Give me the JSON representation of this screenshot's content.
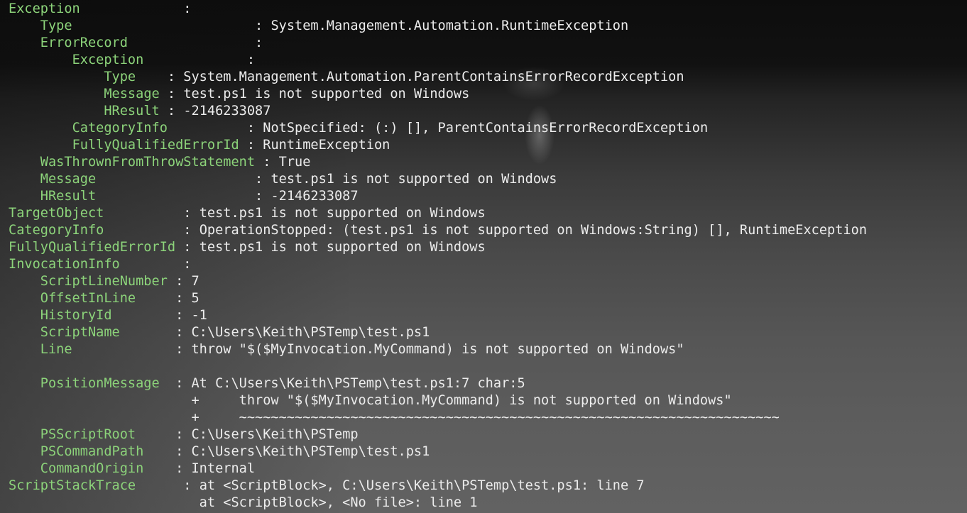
{
  "lines": [
    {
      "indent": "",
      "key": "Exception",
      "sep": "             :",
      "value": ""
    },
    {
      "indent": "    ",
      "key": "Type",
      "sep": "                       : ",
      "value": "System.Management.Automation.RuntimeException"
    },
    {
      "indent": "    ",
      "key": "ErrorRecord",
      "sep": "                : ",
      "value": ""
    },
    {
      "indent": "        ",
      "key": "Exception",
      "sep": "             :",
      "value": ""
    },
    {
      "indent": "            ",
      "key": "Type",
      "sep": "    : ",
      "value": "System.Management.Automation.ParentContainsErrorRecordException"
    },
    {
      "indent": "            ",
      "key": "Message",
      "sep": " : ",
      "value": "test.ps1 is not supported on Windows"
    },
    {
      "indent": "            ",
      "key": "HResult",
      "sep": " : ",
      "value": "-2146233087"
    },
    {
      "indent": "        ",
      "key": "CategoryInfo",
      "sep": "          : ",
      "value": "NotSpecified: (:) [], ParentContainsErrorRecordException"
    },
    {
      "indent": "        ",
      "key": "FullyQualifiedErrorId",
      "sep": " : ",
      "value": "RuntimeException"
    },
    {
      "indent": "    ",
      "key": "WasThrownFromThrowStatement",
      "sep": " : ",
      "value": "True"
    },
    {
      "indent": "    ",
      "key": "Message",
      "sep": "                    : ",
      "value": "test.ps1 is not supported on Windows"
    },
    {
      "indent": "    ",
      "key": "HResult",
      "sep": "                    : ",
      "value": "-2146233087"
    },
    {
      "indent": "",
      "key": "TargetObject",
      "sep": "          : ",
      "value": "test.ps1 is not supported on Windows"
    },
    {
      "indent": "",
      "key": "CategoryInfo",
      "sep": "          : ",
      "value": "OperationStopped: (test.ps1 is not supported on Windows:String) [], RuntimeException"
    },
    {
      "indent": "",
      "key": "FullyQualifiedErrorId",
      "sep": " : ",
      "value": "test.ps1 is not supported on Windows"
    },
    {
      "indent": "",
      "key": "InvocationInfo",
      "sep": "        :",
      "value": ""
    },
    {
      "indent": "    ",
      "key": "ScriptLineNumber",
      "sep": " : ",
      "value": "7"
    },
    {
      "indent": "    ",
      "key": "OffsetInLine",
      "sep": "     : ",
      "value": "5"
    },
    {
      "indent": "    ",
      "key": "HistoryId",
      "sep": "        : ",
      "value": "-1"
    },
    {
      "indent": "    ",
      "key": "ScriptName",
      "sep": "       : ",
      "value": "C:\\Users\\Keith\\PSTemp\\test.ps1"
    },
    {
      "indent": "    ",
      "key": "Line",
      "sep": "             : ",
      "value": "throw \"$($MyInvocation.MyCommand) is not supported on Windows\""
    },
    {
      "indent": "",
      "key": "",
      "sep": "",
      "value": ""
    },
    {
      "indent": "    ",
      "key": "PositionMessage",
      "sep": "  : ",
      "value": "At C:\\Users\\Keith\\PSTemp\\test.ps1:7 char:5"
    },
    {
      "indent": "",
      "key": "",
      "sep": "",
      "value": "                       +     throw \"$($MyInvocation.MyCommand) is not supported on Windows\""
    },
    {
      "indent": "",
      "key": "",
      "sep": "",
      "value": "                       +     ~~~~~~~~~~~~~~~~~~~~~~~~~~~~~~~~~~~~~~~~~~~~~~~~~~~~~~~~~~~~~~~~~~~~"
    },
    {
      "indent": "    ",
      "key": "PSScriptRoot",
      "sep": "     : ",
      "value": "C:\\Users\\Keith\\PSTemp"
    },
    {
      "indent": "    ",
      "key": "PSCommandPath",
      "sep": "    : ",
      "value": "C:\\Users\\Keith\\PSTemp\\test.ps1"
    },
    {
      "indent": "    ",
      "key": "CommandOrigin",
      "sep": "    : ",
      "value": "Internal"
    },
    {
      "indent": "",
      "key": "ScriptStackTrace",
      "sep": "      : ",
      "value": "at <ScriptBlock>, C:\\Users\\Keith\\PSTemp\\test.ps1: line 7"
    },
    {
      "indent": "",
      "key": "",
      "sep": "",
      "value": "                        at <ScriptBlock>, <No file>: line 1"
    }
  ]
}
